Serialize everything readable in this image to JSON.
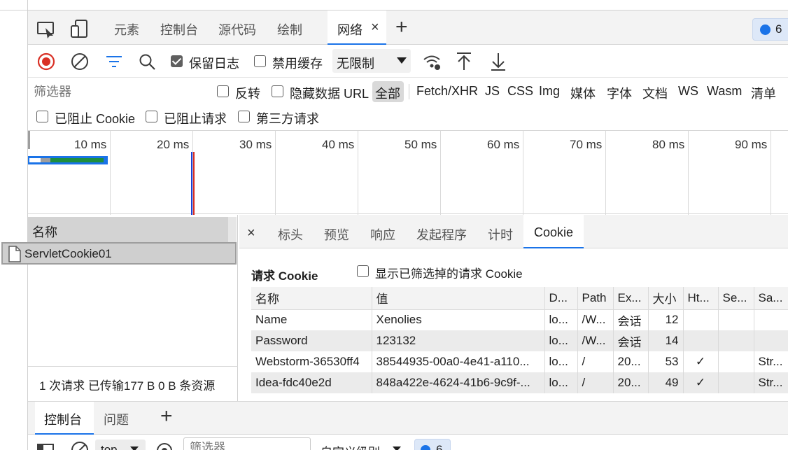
{
  "main_tabs": {
    "inspect_icon": "inspect-icon",
    "device_icon": "device-toggle-icon",
    "elements": "元素",
    "console": "控制台",
    "sources": "源代码",
    "rendering": "绘制",
    "network": "网络",
    "close": "×",
    "add": "+",
    "issues_count": "6"
  },
  "toolbar": {
    "preserve_log": "保留日志",
    "disable_cache": "禁用缓存",
    "throttling": "无限制",
    "preserve_log_checked": true,
    "disable_cache_checked": false
  },
  "filters": {
    "placeholder": "筛选器",
    "invert": "反转",
    "hide_data_url": "隐藏数据 URL",
    "types": [
      "全部",
      "Fetch/XHR",
      "JS",
      "CSS",
      "Img",
      "媒体",
      "字体",
      "文档",
      "WS",
      "Wasm",
      "清单"
    ],
    "blocked_cookies": "已阻止 Cookie",
    "blocked_requests": "已阻止请求",
    "third_party": "第三方请求"
  },
  "timeline": {
    "labels": [
      "10 ms",
      "20 ms",
      "30 ms",
      "40 ms",
      "50 ms",
      "60 ms",
      "70 ms",
      "80 ms",
      "90 ms"
    ]
  },
  "request_list": {
    "header": "名称",
    "items": [
      "ServletCookie01"
    ],
    "summary": "1 次请求  已传输177 B  0 B 条资源"
  },
  "detail_tabs": {
    "close": "×",
    "headers": "标头",
    "preview": "预览",
    "response": "响应",
    "initiator": "发起程序",
    "timing": "计时",
    "cookies": "Cookie"
  },
  "cookies": {
    "section_title": "请求 Cookie",
    "show_filtered": "显示已筛选掉的请求 Cookie",
    "columns": [
      "名称",
      "值",
      "D...",
      "Path",
      "Ex...",
      "大小",
      "Ht...",
      "Se...",
      "Sa..."
    ],
    "rows": [
      [
        "Name",
        "Xenolies",
        "lo...",
        "/W...",
        "会话",
        "12",
        "",
        "",
        ""
      ],
      [
        "Password",
        "123132",
        "lo...",
        "/W...",
        "会话",
        "14",
        "",
        "",
        ""
      ],
      [
        "Webstorm-36530ff4",
        "38544935-00a0-4e41-a110...",
        "lo...",
        "/",
        "20...",
        "53",
        "✓",
        "",
        "Str..."
      ],
      [
        "Idea-fdc40e2d",
        "848a422e-4624-41b6-9c9f-...",
        "lo...",
        "/",
        "20...",
        "49",
        "✓",
        "",
        "Str..."
      ]
    ]
  },
  "drawer": {
    "console": "控制台",
    "issues": "问题",
    "add": "+",
    "context": "top",
    "filter_placeholder": "筛选器",
    "levels": "自定义级别",
    "issues_count": "6"
  },
  "colors": {
    "accent": "#1a73e8",
    "record": "#d93025",
    "waterfall_green": "#1e8e3e"
  }
}
